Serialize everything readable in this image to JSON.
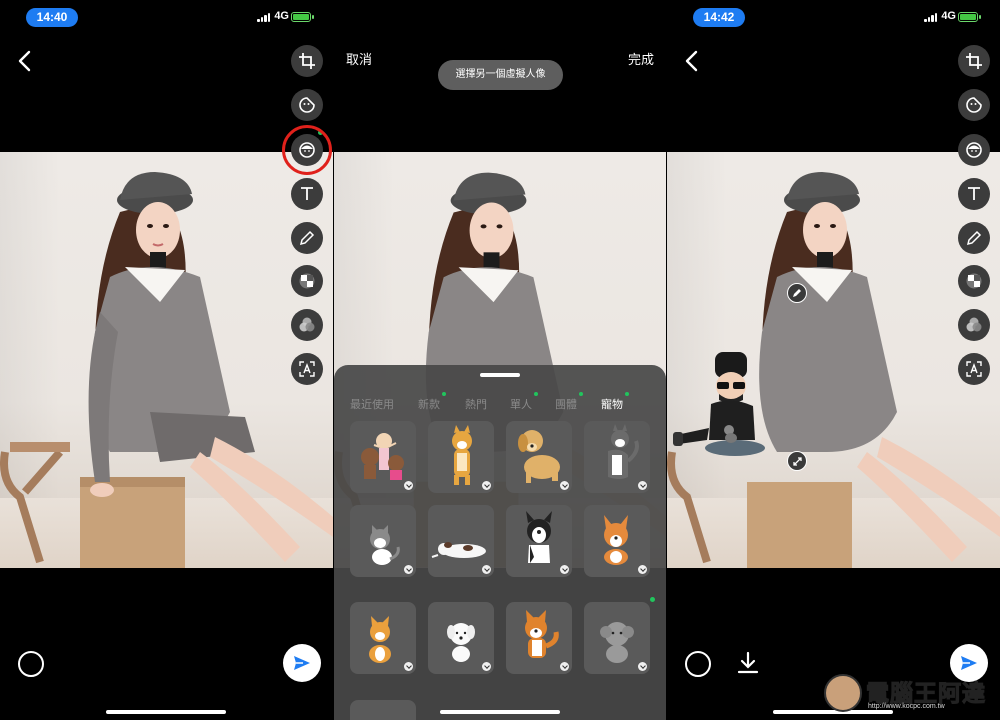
{
  "screens": [
    {
      "time": "14:40",
      "network": "4G",
      "tools": [
        "crop",
        "sticker",
        "avatar",
        "text",
        "pen",
        "mosaic",
        "filter",
        "ocr"
      ]
    },
    {
      "cancel_label": "取消",
      "done_label": "完成",
      "tooltip": "選擇另一個虛擬人像",
      "tabs": [
        "最近使用",
        "新款",
        "熱門",
        "單人",
        "團體",
        "寵物"
      ],
      "active_tab": "寵物",
      "sticker_items": [
        "couple-sticker",
        "shiba-standing-sticker",
        "golden-retriever-sticker",
        "husky-sticker",
        "cat-sticker",
        "sleeping-dog-sticker",
        "french-bulldog-sticker",
        "corgi-sticker",
        "shiba-sitting-sticker",
        "white-dog-sticker",
        "akita-sticker",
        "grey-poodle-sticker"
      ]
    },
    {
      "time": "14:42",
      "network": "4G",
      "tools": [
        "crop",
        "sticker",
        "avatar",
        "text",
        "pen",
        "mosaic",
        "filter",
        "ocr"
      ]
    }
  ],
  "watermark": {
    "text": "電腦王阿達",
    "url": "http://www.kocpc.com.tw"
  },
  "colors": {
    "highlight_ring": "#e0211b",
    "accent_blue": "#1e7cf2",
    "new_dot": "#21c55d"
  }
}
